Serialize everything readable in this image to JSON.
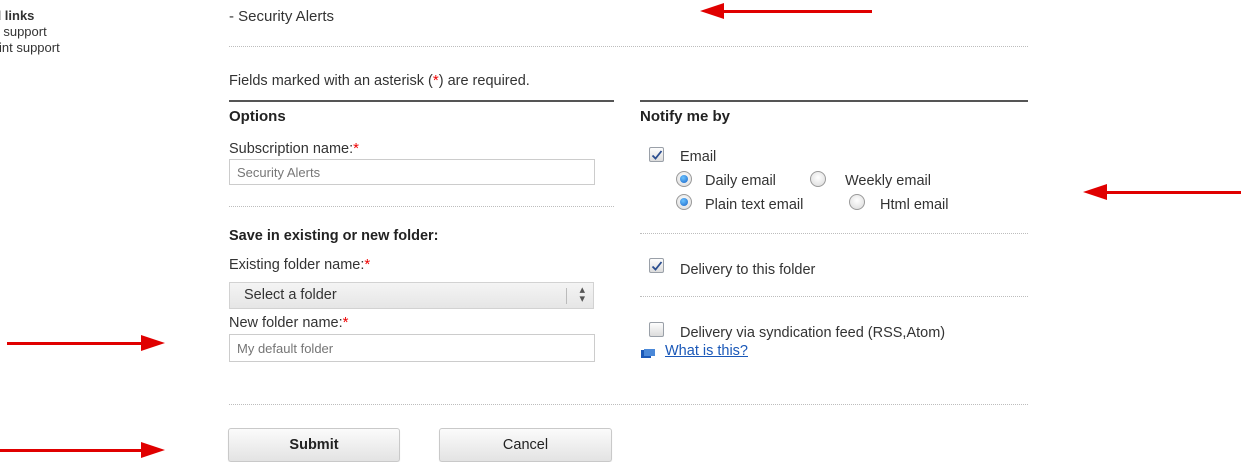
{
  "side": {
    "heading": "ed links",
    "links": [
      "vo support",
      "Print support"
    ]
  },
  "breadcrumb": "- Security Alerts",
  "required_note": {
    "before": "Fields marked with an asterisk (",
    "star": "*",
    "after": ") are required."
  },
  "options": {
    "heading": "Options",
    "subscription_label": "Subscription name:",
    "subscription_value": "Security Alerts",
    "folder_heading": "Save in existing or new folder:",
    "existing_label": "Existing folder name:",
    "existing_selected": "Select a folder",
    "new_label": "New folder name:",
    "new_placeholder": "My default folder"
  },
  "notify": {
    "heading": "Notify me by",
    "email_label": "Email",
    "email_checked": true,
    "daily_label": "Daily email",
    "weekly_label": "Weekly email",
    "frequency_selected": "Daily email",
    "plain_label": "Plain text email",
    "html_label": "Html email",
    "format_selected": "Plain text email",
    "folder_delivery_label": "Delivery to this folder",
    "folder_delivery_checked": true,
    "syndication_label": "Delivery via syndication feed (RSS,Atom)",
    "syndication_checked": false,
    "whatis_link": "What is this?"
  },
  "buttons": {
    "submit": "Submit",
    "cancel": "Cancel"
  },
  "colors": {
    "annotation_arrow": "#e00000",
    "required_star": "#e00000",
    "link": "#1a58b8"
  }
}
